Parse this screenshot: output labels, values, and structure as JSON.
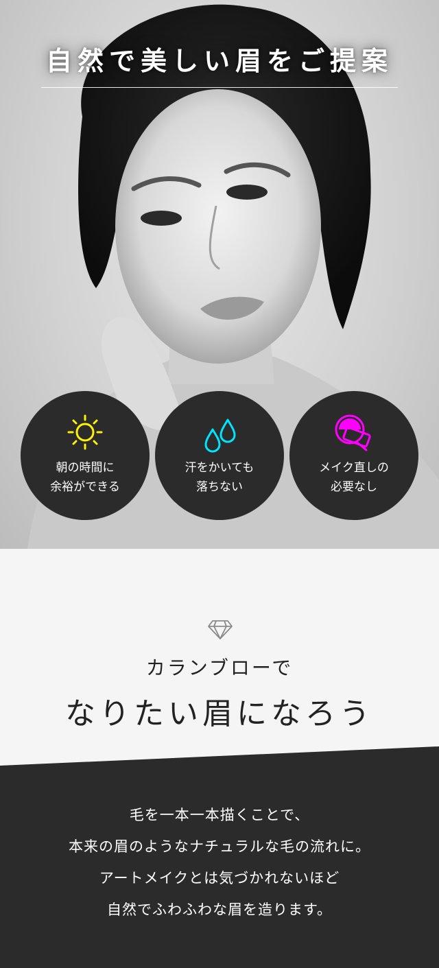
{
  "hero": {
    "title": "自然で美しい眉をご提案",
    "features": [
      {
        "icon": "sun-icon",
        "label": "朝の時間に\n余裕ができる",
        "color": "#fff200"
      },
      {
        "icon": "water-drops-icon",
        "label": "汗をかいても\n落ちない",
        "color": "#00e5ff"
      },
      {
        "icon": "makeup-compact-icon",
        "label": "メイク直しの\n必要なし",
        "color": "#ff00ff"
      }
    ]
  },
  "intro": {
    "icon": "diamond-icon",
    "subtitle": "カランブローで",
    "title": "なりたい眉になろう"
  },
  "body": {
    "lines": [
      "毛を一本一本描くことで、",
      "本来の眉のようなナチュラルな毛の流れに。",
      "アートメイクとは気づかれないほど",
      "自然でふわふわな眉を造ります。"
    ]
  },
  "colors": {
    "dark_bg": "#2b2b2b",
    "light_bg": "#f5f5f5",
    "accent_sun": "#fff200",
    "accent_water": "#00e5ff",
    "accent_makeup": "#ff00ff"
  }
}
